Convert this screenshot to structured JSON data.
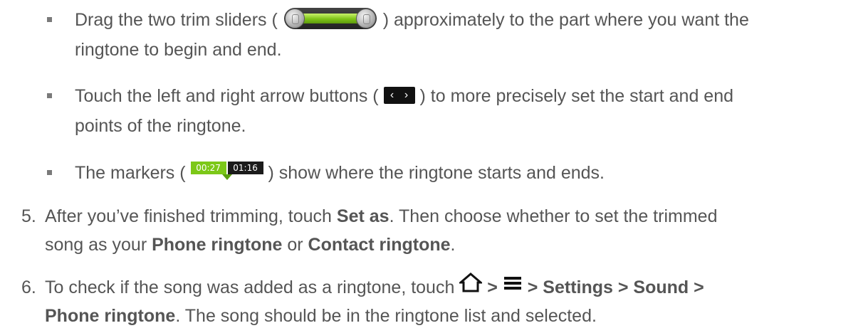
{
  "bullets": [
    {
      "before": "Drag the two trim sliders (",
      "after": ") approximately to the part where you want the",
      "cont": "ringtone to begin and end."
    },
    {
      "before": "Touch the left and right arrow buttons (",
      "after": ") to more precisely set the start and end",
      "cont": "points of the ringtone."
    },
    {
      "before": "The markers (",
      "after": ") show where the ringtone starts and ends."
    }
  ],
  "arrow_buttons": {
    "left": "‹",
    "right": "›"
  },
  "markers": {
    "start": "00:27",
    "end": "01:16"
  },
  "step5": {
    "num": "5.",
    "t1": "After you’ve finished trimming, touch ",
    "b1": "Set as",
    "t2": ". Then choose whether to set the trimmed",
    "t3": "song as your ",
    "b2": "Phone ringtone",
    "t4": " or ",
    "b3": "Contact ringtone",
    "t5": "."
  },
  "step6": {
    "num": "6.",
    "t1": "To check if the song was added as a ringtone, touch ",
    "sep1": " > ",
    "b_path": " > Settings > Sound >",
    "b_line2": "Phone ringtone",
    "t2": ". The song should be in the ringtone list and selected."
  },
  "icons": [
    "trim-slider-icon",
    "arrow-buttons-icon",
    "markers-icon",
    "home-icon",
    "menu-icon"
  ]
}
